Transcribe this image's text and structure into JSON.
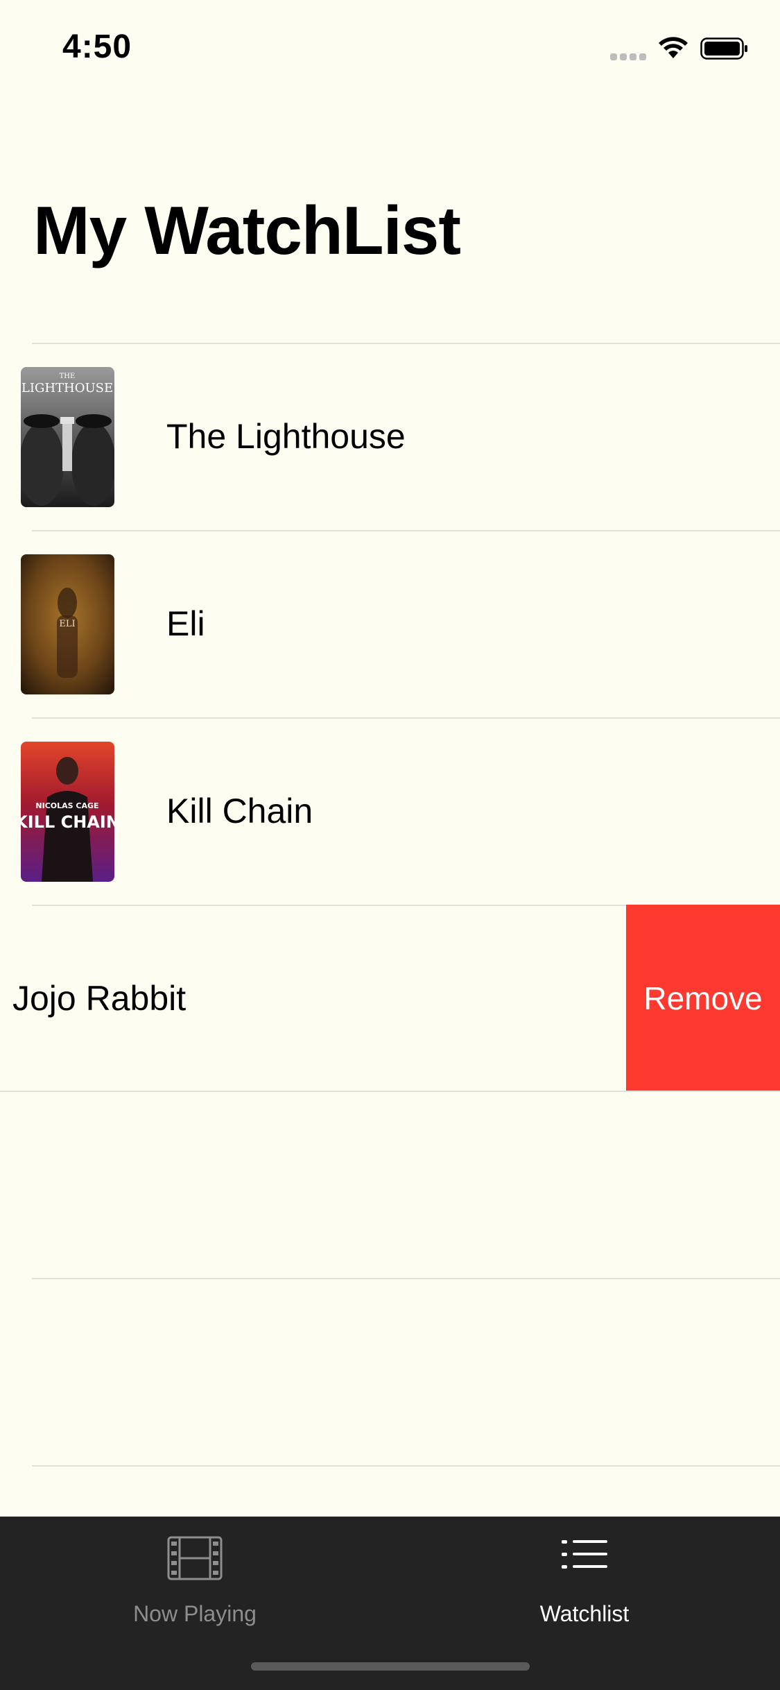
{
  "status": {
    "time": "4:50"
  },
  "header": {
    "title": "My WatchList"
  },
  "items": [
    {
      "title": "The Lighthouse",
      "poster_text_top": "THE",
      "poster_text_main": "LIGHTHOUSE"
    },
    {
      "title": "Eli",
      "poster_text_main": "ELI"
    },
    {
      "title": "Kill Chain",
      "poster_text_top": "NICOLAS CAGE",
      "poster_text_main": "KILL CHAIN"
    },
    {
      "title": "Jojo Rabbit"
    }
  ],
  "swipe_action": {
    "label": "Remove",
    "color": "#FE3A30"
  },
  "tabs": [
    {
      "label": "Now Playing",
      "icon": "film-icon",
      "selected": false
    },
    {
      "label": "Watchlist",
      "icon": "list-icon",
      "selected": true
    }
  ],
  "colors": {
    "background": "#FEFDF2",
    "tab_bar": "#232323",
    "destructive": "#FE3A30"
  }
}
